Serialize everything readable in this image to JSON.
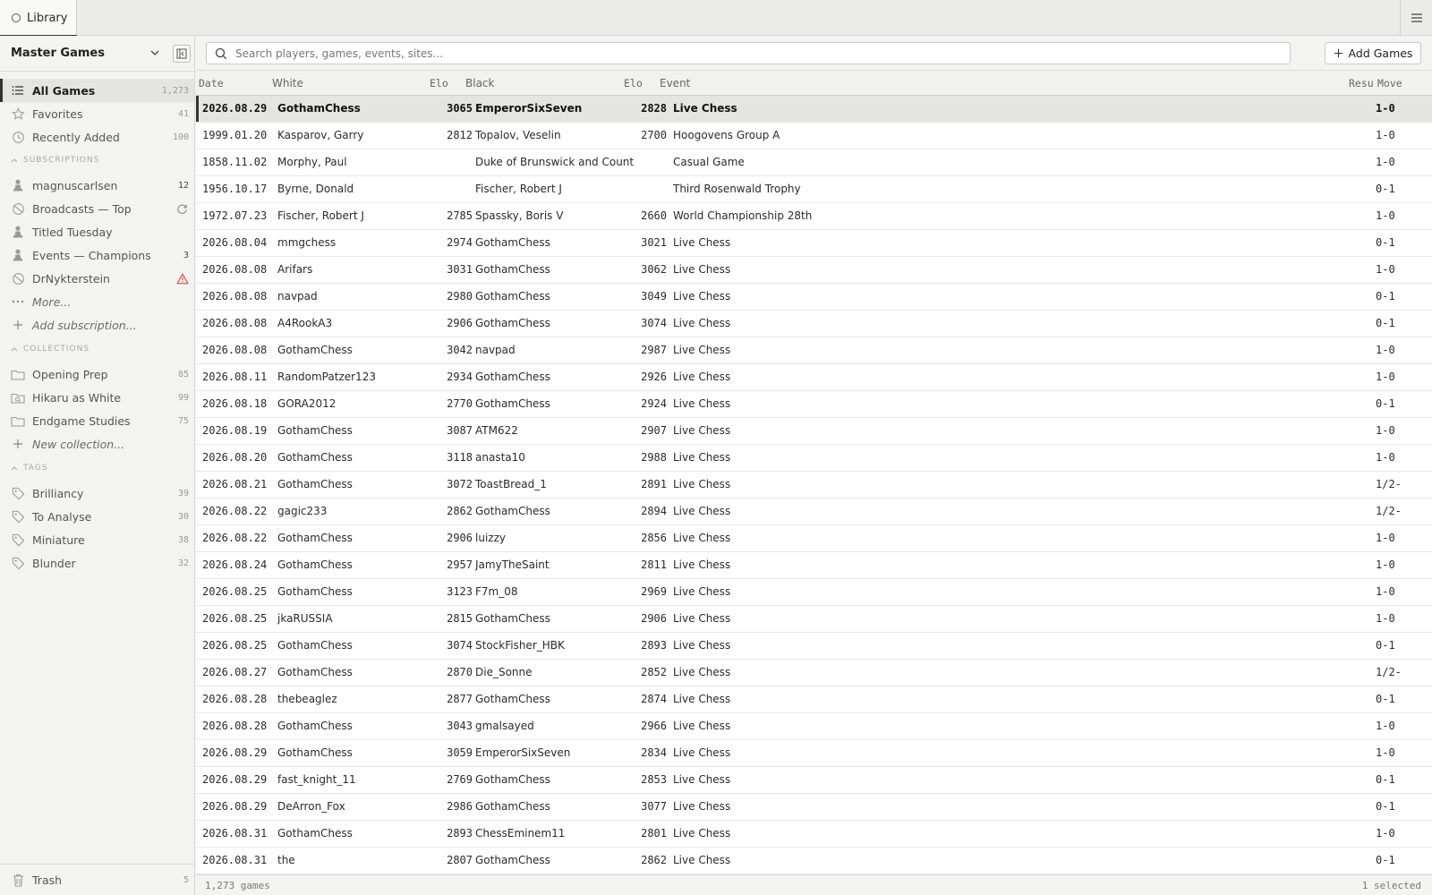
{
  "tab": {
    "label": "Library"
  },
  "sidebar": {
    "title": "Master Games",
    "library": [
      {
        "label": "All Games",
        "count": "1,273",
        "icon": "list-icon"
      },
      {
        "label": "Favorites",
        "count": "41",
        "icon": "star-icon"
      },
      {
        "label": "Recently Added",
        "count": "100",
        "icon": "clock-icon"
      }
    ],
    "subscriptions_header": "SUBSCRIPTIONS",
    "subscriptions": [
      {
        "label": "magnuscarlsen",
        "count": "12",
        "icon": "pawn-icon"
      },
      {
        "label": "Broadcasts — Top",
        "status": "refresh-icon",
        "icon": "broadcast-icon"
      },
      {
        "label": "Titled Tuesday",
        "icon": "pawn-icon"
      },
      {
        "label": "Events — Champions",
        "count": "3",
        "icon": "pawn-icon"
      },
      {
        "label": "DrNykterstein",
        "status": "warning-icon",
        "icon": "broadcast-icon"
      }
    ],
    "more_label": "More...",
    "add_subscription_label": "Add subscription...",
    "collections_header": "COLLECTIONS",
    "collections": [
      {
        "label": "Opening Prep",
        "count": "85",
        "icon": "folder-icon"
      },
      {
        "label": "Hikaru as White",
        "count": "99",
        "icon": "smart-folder-icon"
      },
      {
        "label": "Endgame Studies",
        "count": "75",
        "icon": "folder-icon"
      }
    ],
    "new_collection_label": "New collection...",
    "tags_header": "TAGS",
    "tags": [
      {
        "label": "Brilliancy",
        "count": "39",
        "icon": "tag-icon"
      },
      {
        "label": "To Analyse",
        "count": "30",
        "icon": "tag-icon"
      },
      {
        "label": "Miniature",
        "count": "38",
        "icon": "tag-icon"
      },
      {
        "label": "Blunder",
        "count": "32",
        "icon": "tag-icon"
      }
    ],
    "trash": {
      "label": "Trash",
      "count": "5"
    }
  },
  "search": {
    "placeholder": "Search players, games, events, sites..."
  },
  "add_button_label": "Add Games",
  "columns": {
    "date": "Date",
    "white": "White",
    "white_elo": "Elo",
    "black": "Black",
    "black_elo": "Elo",
    "event": "Event",
    "result": "Resu",
    "moves": "Move"
  },
  "games": [
    {
      "date": "2026.08.29",
      "white": "GothamChess",
      "welo": "3065",
      "black": "EmperorSixSeven",
      "belo": "2828",
      "event": "Live Chess",
      "result": "1-0",
      "selected": true
    },
    {
      "date": "1999.01.20",
      "white": "Kasparov, Garry",
      "welo": "2812",
      "black": "Topalov, Veselin",
      "belo": "2700",
      "event": "Hoogovens Group A",
      "result": "1-0"
    },
    {
      "date": "1858.11.02",
      "white": "Morphy, Paul",
      "welo": "",
      "black": "Duke of Brunswick and Count Is",
      "belo": "",
      "event": "Casual Game",
      "result": "1-0"
    },
    {
      "date": "1956.10.17",
      "white": "Byrne, Donald",
      "welo": "",
      "black": "Fischer, Robert J",
      "belo": "",
      "event": "Third Rosenwald Trophy",
      "result": "0-1"
    },
    {
      "date": "1972.07.23",
      "white": "Fischer, Robert J",
      "welo": "2785",
      "black": "Spassky, Boris V",
      "belo": "2660",
      "event": "World Championship 28th",
      "result": "1-0"
    },
    {
      "date": "2026.08.04",
      "white": "mmgchess",
      "welo": "2974",
      "black": "GothamChess",
      "belo": "3021",
      "event": "Live Chess",
      "result": "0-1"
    },
    {
      "date": "2026.08.08",
      "white": "Arifars",
      "welo": "3031",
      "black": "GothamChess",
      "belo": "3062",
      "event": "Live Chess",
      "result": "1-0"
    },
    {
      "date": "2026.08.08",
      "white": "navpad",
      "welo": "2980",
      "black": "GothamChess",
      "belo": "3049",
      "event": "Live Chess",
      "result": "0-1"
    },
    {
      "date": "2026.08.08",
      "white": "A4RookA3",
      "welo": "2906",
      "black": "GothamChess",
      "belo": "3074",
      "event": "Live Chess",
      "result": "0-1"
    },
    {
      "date": "2026.08.08",
      "white": "GothamChess",
      "welo": "3042",
      "black": "navpad",
      "belo": "2987",
      "event": "Live Chess",
      "result": "1-0"
    },
    {
      "date": "2026.08.11",
      "white": "RandomPatzer123",
      "welo": "2934",
      "black": "GothamChess",
      "belo": "2926",
      "event": "Live Chess",
      "result": "1-0"
    },
    {
      "date": "2026.08.18",
      "white": "GORA2012",
      "welo": "2770",
      "black": "GothamChess",
      "belo": "2924",
      "event": "Live Chess",
      "result": "0-1"
    },
    {
      "date": "2026.08.19",
      "white": "GothamChess",
      "welo": "3087",
      "black": "ATM622",
      "belo": "2907",
      "event": "Live Chess",
      "result": "1-0"
    },
    {
      "date": "2026.08.20",
      "white": "GothamChess",
      "welo": "3118",
      "black": "anasta10",
      "belo": "2988",
      "event": "Live Chess",
      "result": "1-0"
    },
    {
      "date": "2026.08.21",
      "white": "GothamChess",
      "welo": "3072",
      "black": "ToastBread_1",
      "belo": "2891",
      "event": "Live Chess",
      "result": "1/2-"
    },
    {
      "date": "2026.08.22",
      "white": "gagic233",
      "welo": "2862",
      "black": "GothamChess",
      "belo": "2894",
      "event": "Live Chess",
      "result": "1/2-"
    },
    {
      "date": "2026.08.22",
      "white": "GothamChess",
      "welo": "2906",
      "black": "luizzy",
      "belo": "2856",
      "event": "Live Chess",
      "result": "1-0"
    },
    {
      "date": "2026.08.24",
      "white": "GothamChess",
      "welo": "2957",
      "black": "JamyTheSaint",
      "belo": "2811",
      "event": "Live Chess",
      "result": "1-0"
    },
    {
      "date": "2026.08.25",
      "white": "GothamChess",
      "welo": "3123",
      "black": "F7m_08",
      "belo": "2969",
      "event": "Live Chess",
      "result": "1-0"
    },
    {
      "date": "2026.08.25",
      "white": "jkaRUSSIA",
      "welo": "2815",
      "black": "GothamChess",
      "belo": "2906",
      "event": "Live Chess",
      "result": "1-0"
    },
    {
      "date": "2026.08.25",
      "white": "GothamChess",
      "welo": "3074",
      "black": "StockFisher_HBK",
      "belo": "2893",
      "event": "Live Chess",
      "result": "0-1"
    },
    {
      "date": "2026.08.27",
      "white": "GothamChess",
      "welo": "2870",
      "black": "Die_Sonne",
      "belo": "2852",
      "event": "Live Chess",
      "result": "1/2-"
    },
    {
      "date": "2026.08.28",
      "white": "thebeaglez",
      "welo": "2877",
      "black": "GothamChess",
      "belo": "2874",
      "event": "Live Chess",
      "result": "0-1"
    },
    {
      "date": "2026.08.28",
      "white": "GothamChess",
      "welo": "3043",
      "black": "gmalsayed",
      "belo": "2966",
      "event": "Live Chess",
      "result": "1-0"
    },
    {
      "date": "2026.08.29",
      "white": "GothamChess",
      "welo": "3059",
      "black": "EmperorSixSeven",
      "belo": "2834",
      "event": "Live Chess",
      "result": "1-0"
    },
    {
      "date": "2026.08.29",
      "white": "fast_knight_11",
      "welo": "2769",
      "black": "GothamChess",
      "belo": "2853",
      "event": "Live Chess",
      "result": "0-1"
    },
    {
      "date": "2026.08.29",
      "white": "DeArron_Fox",
      "welo": "2986",
      "black": "GothamChess",
      "belo": "3077",
      "event": "Live Chess",
      "result": "0-1"
    },
    {
      "date": "2026.08.31",
      "white": "GothamChess",
      "welo": "2893",
      "black": "ChessEminem11",
      "belo": "2801",
      "event": "Live Chess",
      "result": "1-0"
    },
    {
      "date": "2026.08.31",
      "white": "the",
      "welo": "2807",
      "black": "GothamChess",
      "belo": "2862",
      "event": "Live Chess",
      "result": "0-1"
    }
  ],
  "status": {
    "count": "1,273 games",
    "selected": "1 selected"
  },
  "colors": {
    "accent": "#333333",
    "warning": "#d9534f"
  }
}
